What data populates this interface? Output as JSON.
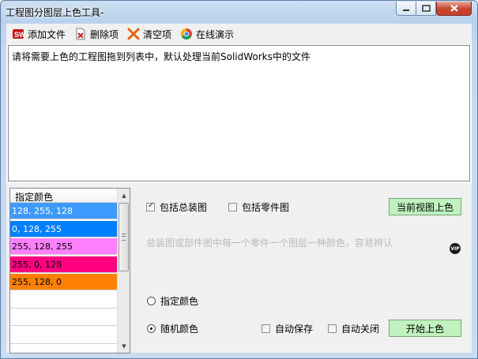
{
  "window": {
    "title": "工程图分图层上色工具-"
  },
  "toolbar": {
    "items": [
      {
        "label": "添加文件",
        "icon": "solidworks-icon"
      },
      {
        "label": "删除项",
        "icon": "delete-document-icon"
      },
      {
        "label": "清空项",
        "icon": "clear-x-icon"
      },
      {
        "label": "在线演示",
        "icon": "chrome-icon"
      }
    ]
  },
  "file_list": {
    "hint": "请将需要上色的工程图拖到列表中，默认处理当前SolidWorks中的文件"
  },
  "color_list": {
    "header": "指定颜色",
    "rows": [
      {
        "label": "128, 255, 128",
        "color": "#3d9bff",
        "text_color": "#ffffff"
      },
      {
        "label": "0, 128, 255",
        "color": "#0080ff",
        "text_color": "#ffffff"
      },
      {
        "label": "255, 128, 255",
        "color": "#ff80ff",
        "text_color": "#000000"
      },
      {
        "label": "255, 0, 128",
        "color": "#ff0080",
        "text_color": "#000000"
      },
      {
        "label": "255, 128, 0",
        "color": "#ff8000",
        "text_color": "#000000"
      },
      {
        "label": "",
        "color": "#ffffff",
        "text_color": "#000000"
      },
      {
        "label": "",
        "color": "#ffffff",
        "text_color": "#000000"
      },
      {
        "label": "",
        "color": "#ffffff",
        "text_color": "#000000"
      }
    ]
  },
  "options": {
    "include_assembly": {
      "label": "包括总装图",
      "checked": true
    },
    "include_parts": {
      "label": "包括零件图",
      "checked": false
    },
    "description": "总装图或部件图中每一个零件一个图层一种颜色，容易辨认",
    "specified_color": {
      "label": "指定颜色",
      "selected": false
    },
    "random_color": {
      "label": "随机颜色",
      "selected": true
    },
    "auto_save": {
      "label": "自动保存",
      "checked": false
    },
    "auto_close": {
      "label": "自动关闭",
      "checked": false
    }
  },
  "buttons": {
    "color_current_view": "当前视图上色",
    "start_coloring": "开始上色",
    "vip": "VIP"
  },
  "colors": {
    "button_green": "#bff2bf",
    "title_gradient_top": "#cfe0f3"
  }
}
